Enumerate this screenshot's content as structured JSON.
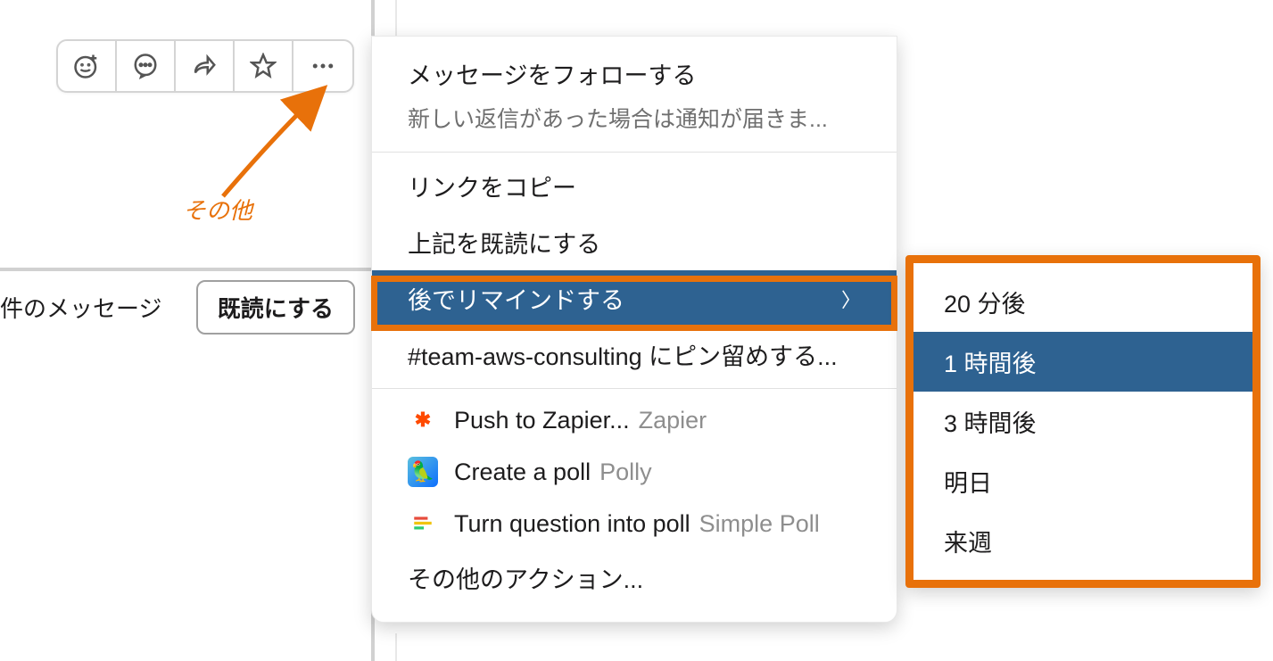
{
  "toolbar": {
    "icons": [
      "emoji-add-icon",
      "thread-icon",
      "share-icon",
      "star-icon",
      "more-icon"
    ]
  },
  "annotation": {
    "label": "その他"
  },
  "message_row": {
    "text": "件のメッセージ",
    "read_button": "既読にする"
  },
  "menu": {
    "follow": {
      "title": "メッセージをフォローする",
      "subtitle": "新しい返信があった場合は通知が届きま..."
    },
    "copy_link": "リンクをコピー",
    "mark_read": "上記を既読にする",
    "remind": "後でリマインドする",
    "pin": "#team-aws-consulting にピン留めする...",
    "apps": [
      {
        "label": "Push to Zapier...",
        "after": "Zapier",
        "icon": "zapier-icon"
      },
      {
        "label": "Create a poll",
        "after": "Polly",
        "icon": "polly-icon"
      },
      {
        "label": "Turn question into poll",
        "after": "Simple Poll",
        "icon": "simple-poll-icon"
      }
    ],
    "more_actions": "その他のアクション..."
  },
  "submenu": {
    "items": [
      "20 分後",
      "1 時間後",
      "3 時間後",
      "明日",
      "来週"
    ],
    "selected_index": 1
  },
  "colors": {
    "accent": "#e8710a",
    "selected": "#2e6291"
  }
}
